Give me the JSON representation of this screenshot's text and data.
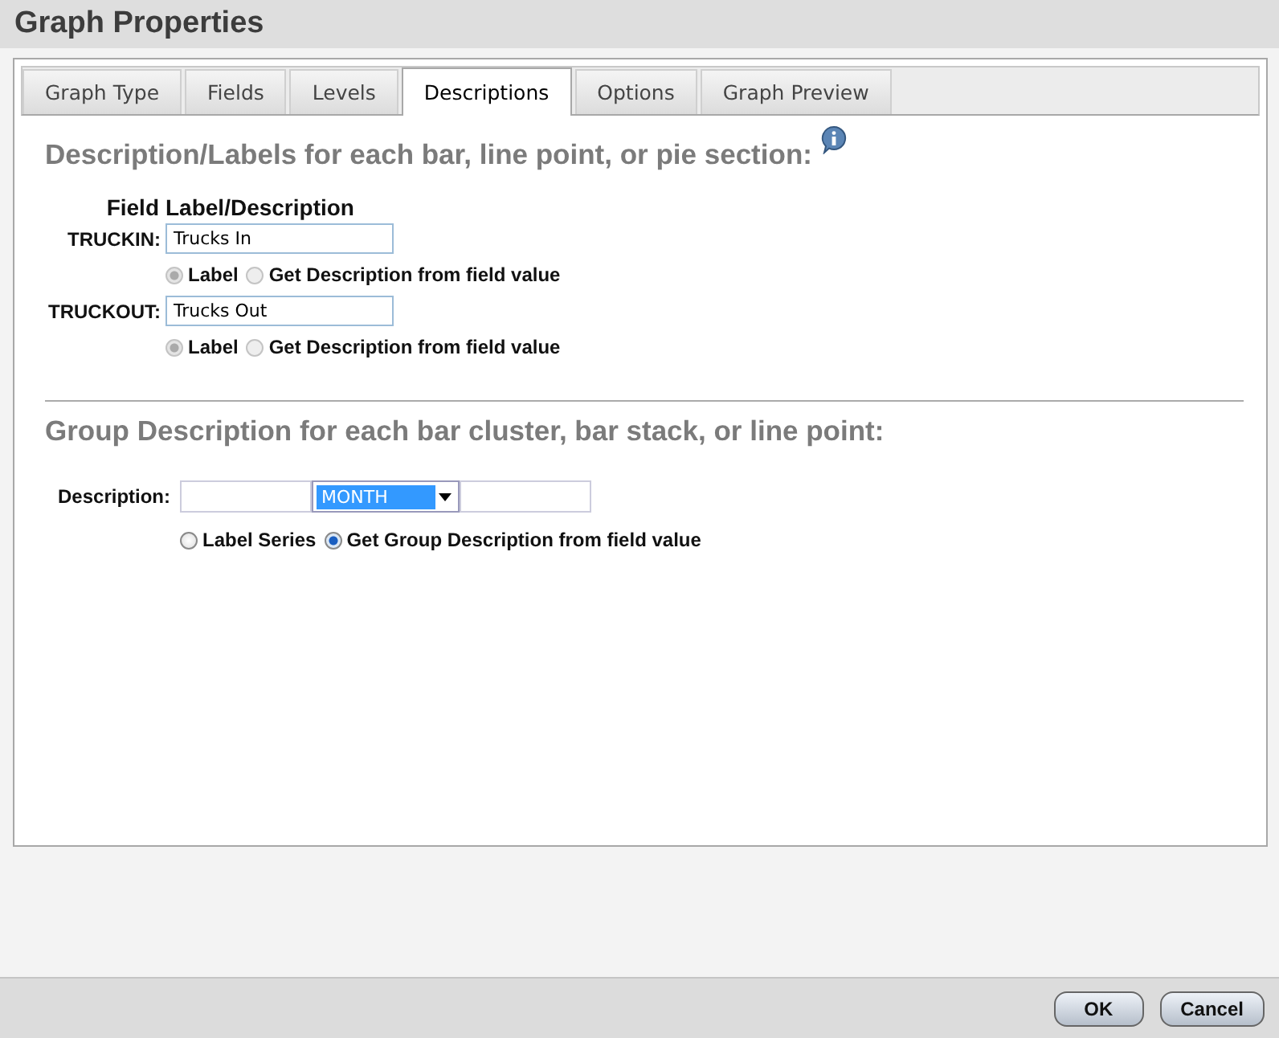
{
  "window": {
    "title": "Graph Properties"
  },
  "tabs": [
    {
      "label": "Graph Type",
      "selected": false
    },
    {
      "label": "Fields",
      "selected": false
    },
    {
      "label": "Levels",
      "selected": false
    },
    {
      "label": "Descriptions",
      "selected": true
    },
    {
      "label": "Options",
      "selected": false
    },
    {
      "label": "Graph Preview",
      "selected": false
    }
  ],
  "labels_section": {
    "heading": "Description/Labels for each bar, line point, or pie section:",
    "column_headers": [
      "Field",
      "Label/Description"
    ],
    "fields": [
      {
        "name": "TRUCKIN:",
        "value": "Trucks In",
        "options": [
          {
            "label": "Label",
            "selected": true,
            "disabled": true
          },
          {
            "label": "Get Description from field value",
            "selected": false,
            "disabled": true
          }
        ]
      },
      {
        "name": "TRUCKOUT:",
        "value": "Trucks Out",
        "options": [
          {
            "label": "Label",
            "selected": true,
            "disabled": true
          },
          {
            "label": "Get Description from field value",
            "selected": false,
            "disabled": true
          }
        ]
      }
    ]
  },
  "group_section": {
    "heading": "Group Description for each bar cluster, bar stack, or line point:",
    "label": "Description:",
    "dropdown": "MONTH",
    "options": [
      {
        "label": "Label Series",
        "selected": false,
        "disabled": false
      },
      {
        "label": "Get Group Description from field value",
        "selected": true,
        "disabled": false
      }
    ]
  },
  "buttons": [
    "OK",
    "Cancel"
  ]
}
